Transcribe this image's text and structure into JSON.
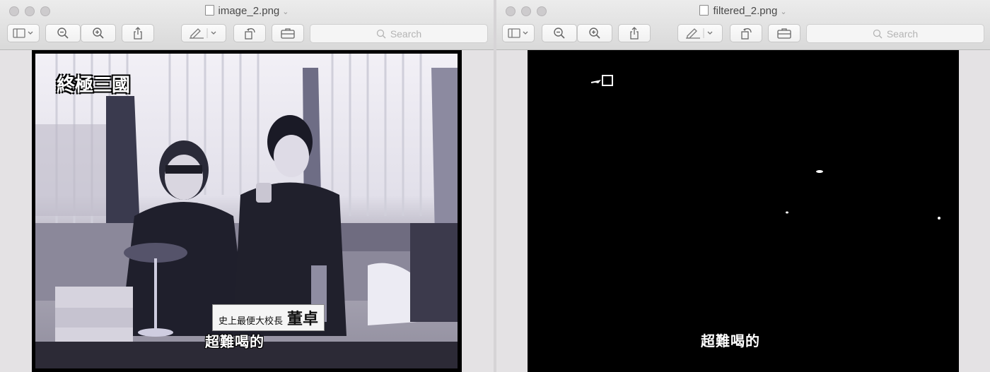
{
  "windows": [
    {
      "title": "image_2.png",
      "search_placeholder": "Search",
      "image": {
        "logo_text": "終極三國",
        "nameplate_small": "史上最便大校長",
        "nameplate_big": "董卓",
        "subtitle": "超難喝的"
      }
    },
    {
      "title": "filtered_2.png",
      "search_placeholder": "Search",
      "image": {
        "subtitle": "超難喝的"
      }
    }
  ],
  "toolbar": {
    "icons": [
      "sidebar-icon",
      "zoom-out-icon",
      "zoom-in-icon",
      "share-icon",
      "markup-icon",
      "rotate-icon",
      "toolbox-icon",
      "search-icon"
    ]
  }
}
